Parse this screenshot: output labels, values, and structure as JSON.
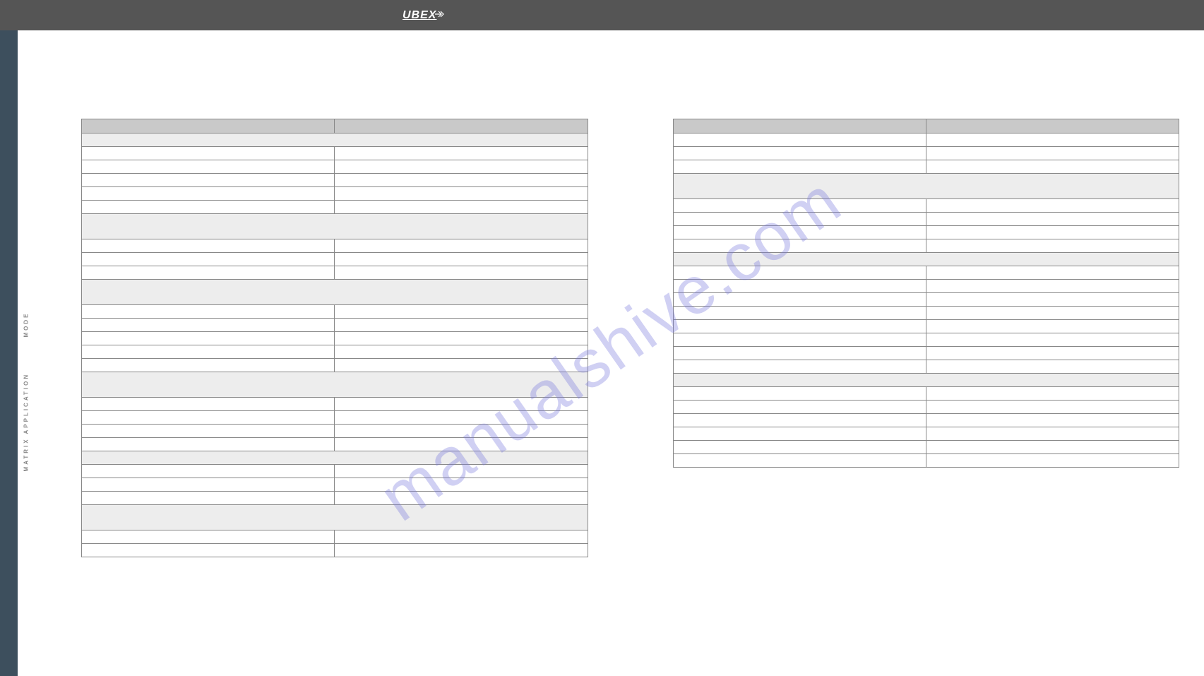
{
  "header": {
    "logo_text": "UBEX"
  },
  "sidebar": {
    "text_upper": "MODE",
    "text_lower": "MATRIX APPLICATION"
  },
  "watermark": "manualshive.com",
  "left_table": {
    "headers": [
      "",
      ""
    ],
    "groups": [
      {
        "type": "section-small",
        "span": 2,
        "label": ""
      },
      {
        "type": "rows",
        "count": 5
      },
      {
        "type": "section",
        "span": 2,
        "label": ""
      },
      {
        "type": "rows",
        "count": 3
      },
      {
        "type": "section",
        "span": 2,
        "label": ""
      },
      {
        "type": "rows",
        "count": 5
      },
      {
        "type": "section",
        "span": 2,
        "label": ""
      },
      {
        "type": "rows",
        "count": 4
      },
      {
        "type": "section-small",
        "span": 2,
        "label": ""
      },
      {
        "type": "rows",
        "count": 3
      },
      {
        "type": "section",
        "span": 2,
        "label": ""
      },
      {
        "type": "rows",
        "count": 2
      }
    ]
  },
  "right_table": {
    "headers": [
      "",
      ""
    ],
    "groups": [
      {
        "type": "rows",
        "count": 3
      },
      {
        "type": "section",
        "span": 2,
        "label": ""
      },
      {
        "type": "rows",
        "count": 4
      },
      {
        "type": "section-small",
        "span": 2,
        "label": ""
      },
      {
        "type": "rows",
        "count": 8
      },
      {
        "type": "section-small",
        "span": 2,
        "label": ""
      },
      {
        "type": "rows",
        "count": 6
      }
    ]
  }
}
